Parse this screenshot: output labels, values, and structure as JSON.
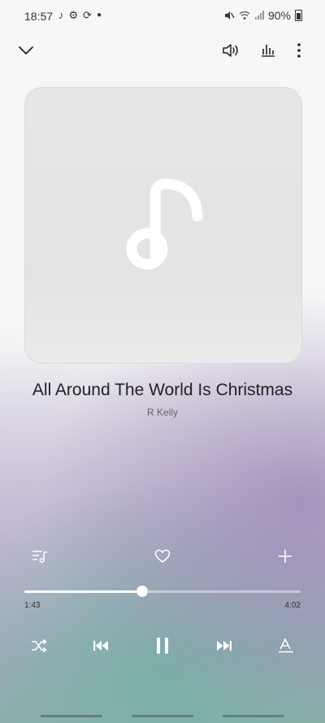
{
  "status_bar": {
    "time": "18:57",
    "battery": "90%",
    "left_icons": [
      "music-note-icon",
      "gear-icon",
      "sync-icon",
      "dot-icon"
    ],
    "right_icons": [
      "mute-icon",
      "wifi-icon",
      "signal-icon",
      "battery-icon"
    ]
  },
  "top_bar": {
    "icons": [
      "chevron-down-icon",
      "volume-icon",
      "equalizer-icon",
      "more-icon"
    ]
  },
  "track": {
    "title": "All Around The World Is Christmas",
    "artist": "R Kelly"
  },
  "playback": {
    "elapsed": "1:43",
    "duration": "4:02",
    "progress_fraction": 0.426
  },
  "action_row": {
    "icons": [
      "queue-icon",
      "heart-icon",
      "add-icon"
    ]
  },
  "controls": {
    "icons": [
      "shuffle-icon",
      "previous-icon",
      "pause-icon",
      "next-icon",
      "lyrics-icon"
    ]
  },
  "colors": {
    "accent": "#ffffff",
    "text": "#222222",
    "subtext": "#666666"
  }
}
